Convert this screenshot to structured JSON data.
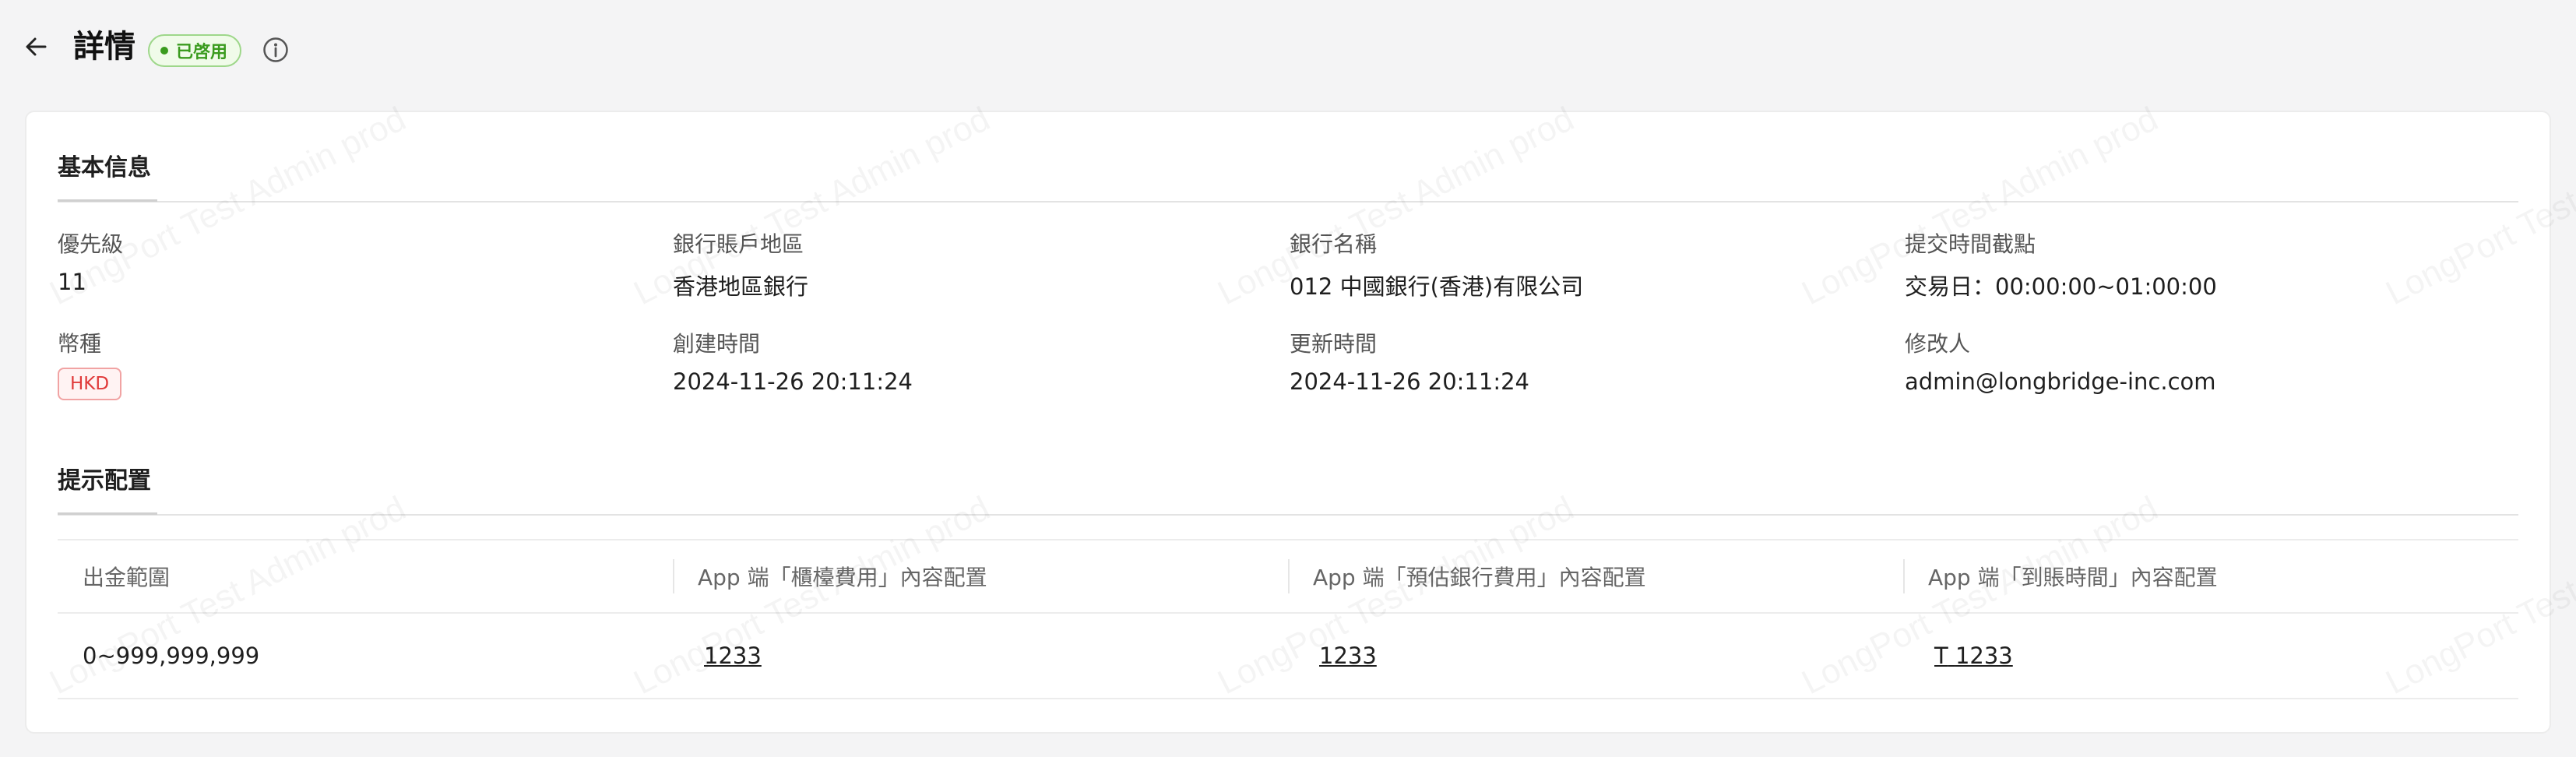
{
  "header": {
    "title": "詳情",
    "status_badge": "已啓用"
  },
  "basic_info": {
    "section_title": "基本信息",
    "fields": [
      {
        "label": "優先級",
        "value": "11"
      },
      {
        "label": "銀行賬戶地區",
        "value": "香港地區銀行"
      },
      {
        "label": "銀行名稱",
        "value": "012 中國銀行(香港)有限公司"
      },
      {
        "label": "提交時間截點",
        "value": "交易日：00:00:00~01:00:00"
      },
      {
        "label": "幣種",
        "value": "HKD"
      },
      {
        "label": "創建時間",
        "value": "2024-11-26 20:11:24"
      },
      {
        "label": "更新時間",
        "value": "2024-11-26 20:11:24"
      },
      {
        "label": "修改人",
        "value": "admin@longbridge-inc.com"
      }
    ]
  },
  "hint_config": {
    "section_title": "提示配置",
    "columns": [
      "出金範圍",
      "App 端「櫃檯費用」內容配置",
      "App 端「預估銀行費用」內容配置",
      "App 端「到賬時間」內容配置"
    ],
    "rows": [
      {
        "range": "0~999,999,999",
        "counter_fee": "1233",
        "bank_fee": "1233",
        "arrival_prefix": "T",
        "arrival_time": "1233"
      }
    ]
  },
  "watermark": "LongPort Test Admin prod",
  "colors": {
    "status_green": "#3a9b1e",
    "tag_red": "#e03a3a"
  }
}
